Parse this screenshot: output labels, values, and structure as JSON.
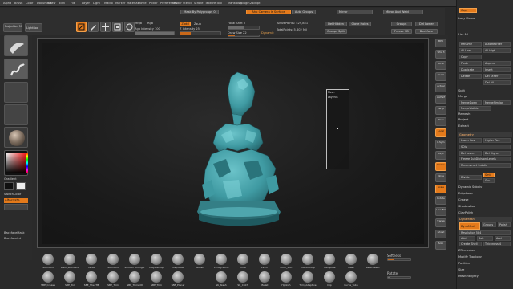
{
  "menubar": {
    "items": [
      "Alpha",
      "Brush",
      "Color",
      "Document",
      "Draw",
      "Edit",
      "File",
      "Layer",
      "Light",
      "Macro",
      "Marker",
      "Material",
      "Movie",
      "Picker",
      "Preferences",
      "Render",
      "Stencil",
      "Stroke",
      "Texture",
      "Tool",
      "Transform",
      "Zplugin",
      "Zscript"
    ]
  },
  "top_left": {
    "projection_master": "Projection Master",
    "lightbox": "LightBox"
  },
  "toolbar": {
    "mask_by_polygroups": "Mask By Polygroups 0",
    "ahp_camera": "Ahp Camera Is Surface",
    "auto_groups": "Auto Groups",
    "mirror": "Mirror",
    "mirror_and_weld": "Mirror And Weld",
    "edit": "Edit",
    "draw": "Draw",
    "move": "Move",
    "scale": "Scale",
    "rotate": "Rotate",
    "mrgb": "Mrgb",
    "rgb": "Rgb",
    "rgb_intensity": "Rgb Intensity 100",
    "zadd": "Zadd",
    "zsub": "Zsub",
    "zcut": "Zcut",
    "z_intensity": "Z Intensity 25",
    "focal_shift": "Focal Shift 0",
    "draw_size": "Draw Size 22",
    "dynamic": "Dynamic",
    "active_points": "ActivePoints: 529,851",
    "total_points": "TotalPoints: 5,602 Mil",
    "del_hidden": "Del Hidden",
    "close_holes": "Close Holes",
    "group_split": "Groups Split",
    "groups": "Groups",
    "del_lower": "Del Lower",
    "freeze_sd": "Freeze SD",
    "backface": "Backface"
  },
  "left_shelf": {
    "gradient": "Gradient",
    "switch_color": "SwitchColor",
    "alternate": "Alternate",
    "backface_mask": "BackfaceMask",
    "backface_intensity": "BackfaceInt"
  },
  "viewport": {
    "popup_line1": "Mesh",
    "popup_line2": "Layer01"
  },
  "right_tools": {
    "items": [
      "BPR",
      "SPix 3",
      "Scroll",
      "Zoom",
      "Actual",
      "AAHalf",
      "Persp",
      "Floor",
      "Local",
      "L.Sym",
      "Gxyz",
      "Frame",
      "Move",
      "Scale",
      "Rotate",
      "Line Fill",
      "Transp",
      "Ghost",
      "Solo",
      "Xpose"
    ]
  },
  "right_panel": {
    "top_label": "Copy",
    "lazy_mouse": "Lazy Mouse",
    "list_all": "List All",
    "rows": [
      {
        "a": "Rename",
        "b": "AutoReorder"
      },
      {
        "a": "All Low",
        "b": "All High"
      },
      {
        "a": "Copy",
        "b": ""
      },
      {
        "a": "Paste",
        "b": "Append"
      },
      {
        "a": "Duplicate",
        "b": "Insert"
      },
      {
        "a": "Delete",
        "b": "Del Other"
      },
      {
        "a": "",
        "b": "Del All"
      }
    ],
    "split": "Split",
    "merge": "Merge",
    "merge_down": "MergeDown",
    "merge_similar": "MergeSimilar",
    "merge_visible": "MergeVisible",
    "remesh": "Remesh",
    "project": "Project",
    "extract": "Extract",
    "geometry": "Geometry",
    "lower_res": "Lower Res",
    "higher_res": "Higher Res",
    "sdiv": "SDiv",
    "del_lower": "Del Lower",
    "del_higher": "Del Higher",
    "freeze": "Freeze SubDivision Levels",
    "reconstruct": "Reconstruct Subdiv",
    "divide": "Divide",
    "smt": "Smt",
    "suv": "Suv",
    "dynamic_subdiv": "Dynamic Subdiv",
    "edge_loop": "EdgeLoop",
    "crease": "Crease",
    "shadow_box": "ShadowBox",
    "clay_polish": "ClayPolish",
    "dynamesh_head": "DynaMesh",
    "dynamesh": "DynaMesh",
    "groups": "Groups",
    "polish": "Polish",
    "resolution": "Resolution 584",
    "add": "Add",
    "sub": "Sub",
    "and": "And",
    "create_shell": "Create Shell",
    "thickness": "Thickness 4",
    "zremesher": "ZRemesher",
    "modify_topology": "Modify Topology",
    "position": "Position",
    "size": "Size",
    "meshintegrity": "MeshIntegrity"
  },
  "bottom_shelf": {
    "brushes_row1": [
      "Standard",
      "Dam_Standard",
      "Move",
      "Standard",
      "Smooth Stronger",
      "ClayBuildup",
      "ClayTubes",
      "hPolish",
      "TrimDynamic",
      "Inflat",
      "Pinch",
      "Form_Soft",
      "Claybuildup",
      "Transpose",
      "Mask",
      "Selectlasso"
    ],
    "brushes_row2": [
      "SBE_Crease",
      "SBE_Pol",
      "SBE_ShellTB",
      "SBE_Trim",
      "SBE_Trimedit",
      "SBE_Trim",
      "SBE_Planar",
      "",
      "SK_Slash",
      "SK_Cloth",
      "Mallet",
      "Hpolish",
      "Trim_Adaptive",
      "Clip",
      "Curve_Tube",
      ""
    ],
    "softness": "Softness",
    "rotate": "Rotate"
  },
  "colors": {
    "accent": "#e47a1b",
    "model": "#4fa6ad"
  }
}
